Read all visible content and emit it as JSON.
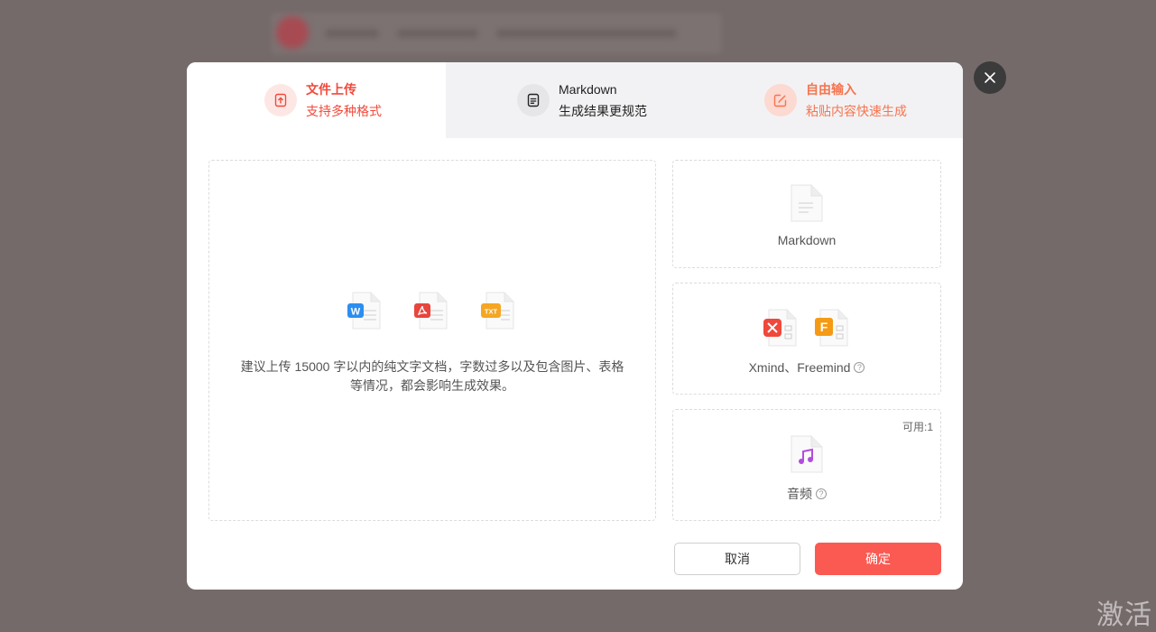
{
  "tabs": [
    {
      "title": "文件上传",
      "subtitle": "支持多种格式",
      "icon": "upload-file-icon",
      "active": true
    },
    {
      "title": "Markdown",
      "subtitle": "生成结果更规范",
      "icon": "document-icon"
    },
    {
      "title": "自由输入",
      "subtitle": "粘贴内容快速生成",
      "icon": "edit-icon"
    }
  ],
  "upload": {
    "file_types": [
      "W",
      "PDF",
      "TXT"
    ],
    "description": "建议上传 15000 字以内的纯文字文档，字数过多以及包含图片、表格等情况，都会影响生成效果。"
  },
  "options": [
    {
      "label": "Markdown",
      "icon": "markdown-file-icon"
    },
    {
      "label": "Xmind、Freemind",
      "icon": "mindmap-file-icon",
      "help": "?"
    },
    {
      "label": "音频",
      "icon": "audio-file-icon",
      "help": "?",
      "badge": "可用:1"
    }
  ],
  "buttons": {
    "cancel": "取消",
    "confirm": "确定"
  },
  "watermark": "激活",
  "colors": {
    "accent": "#fa5a52",
    "active_tab": "#f2493b",
    "orange_tab": "#f6744f"
  }
}
